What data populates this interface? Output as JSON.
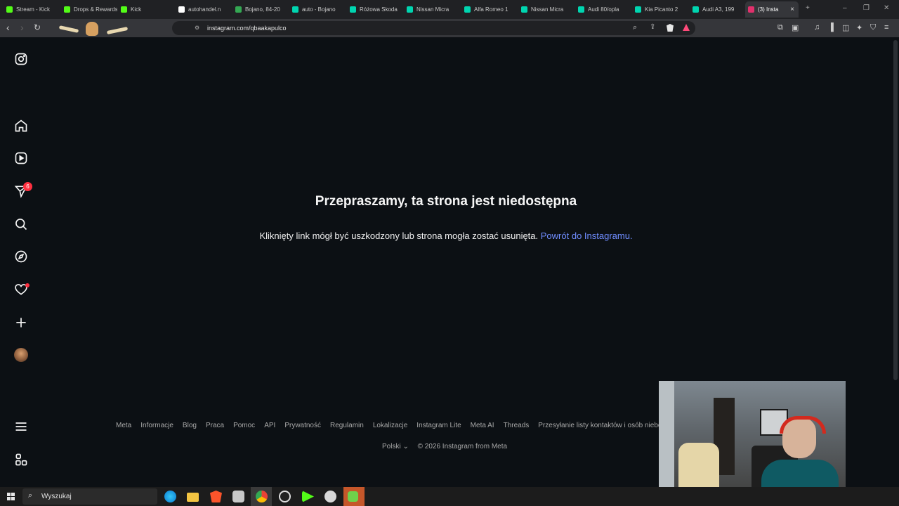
{
  "browser": {
    "tabs": [
      {
        "label": "Stream - Kick",
        "icon": "kick-icon",
        "color": "#53fc18"
      },
      {
        "label": "Drops & Rewards",
        "icon": "kick-icon",
        "color": "#53fc18"
      },
      {
        "label": "Kick",
        "icon": "kick-icon",
        "color": "#53fc18"
      },
      {
        "label": "autohandel.n",
        "icon": "tiktok-icon",
        "color": "#ffffff"
      },
      {
        "label": "Bojano, 84-20",
        "icon": "maps-pin-icon",
        "color": "#34a853"
      },
      {
        "label": "auto - Bojano",
        "icon": "otomoto-icon",
        "color": "#00d5b0"
      },
      {
        "label": "Różowa Skoda",
        "icon": "otomoto-icon",
        "color": "#00d5b0"
      },
      {
        "label": "Nissan Micra",
        "icon": "otomoto-icon",
        "color": "#00d5b0"
      },
      {
        "label": "Alfa Romeo 1",
        "icon": "otomoto-icon",
        "color": "#00d5b0"
      },
      {
        "label": "Nissan Micra",
        "icon": "otomoto-icon",
        "color": "#00d5b0"
      },
      {
        "label": "Audi 80/opla",
        "icon": "otomoto-icon",
        "color": "#00d5b0"
      },
      {
        "label": "Kia Picanto 2",
        "icon": "otomoto-icon",
        "color": "#00d5b0"
      },
      {
        "label": "Audi A3, 199",
        "icon": "otomoto-icon",
        "color": "#00d5b0"
      }
    ],
    "active_tab": {
      "label": "(3) Insta",
      "icon": "instagram-icon",
      "color": "#e1306c"
    },
    "url": "instagram.com/qbaakapulco"
  },
  "instagram": {
    "title": "Przepraszamy, ta strona jest niedostępna",
    "message": "Kliknięty link mógł być uszkodzony lub strona mogła zostać usunięta.",
    "back_link": "Powrót do Instagramu.",
    "notification_count": "6",
    "footer_links": [
      "Meta",
      "Informacje",
      "Blog",
      "Praca",
      "Pomoc",
      "API",
      "Prywatność",
      "Regulamin",
      "Lokalizacje",
      "Instagram Lite",
      "Meta AI",
      "Threads",
      "Przesyłanie listy kontaktów i osób niebędących użytkownikami"
    ],
    "language": "Polski",
    "copyright": "© 2026 Instagram from Meta",
    "link_color": "#708dff"
  },
  "taskbar": {
    "search_placeholder": "Wyszukaj"
  }
}
